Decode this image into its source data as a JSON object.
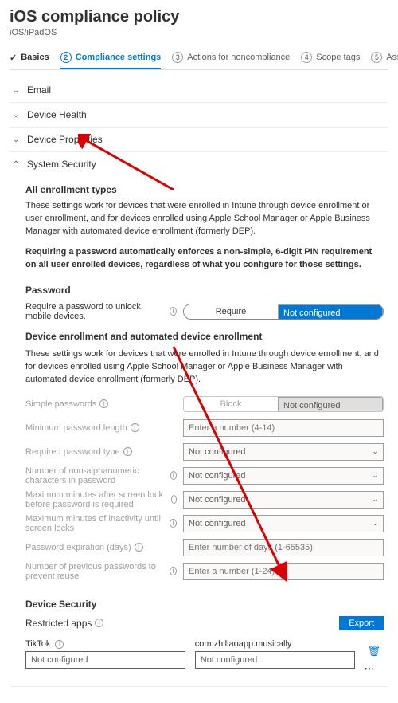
{
  "header": {
    "title": "iOS compliance policy",
    "subtitle": "iOS/iPadOS"
  },
  "wizard": {
    "s1": "Basics",
    "s2": "Compliance settings",
    "s3": "Actions for noncompliance",
    "s4": "Scope tags",
    "s5": "Assignments",
    "n2": "2",
    "n3": "3",
    "n4": "4",
    "n5": "5"
  },
  "sections": {
    "email": "Email",
    "health": "Device Health",
    "props": "Device Properties",
    "security": "System Security"
  },
  "content": {
    "allEnroll": "All enrollment types",
    "allEnrollDesc": "These settings work for devices that were enrolled in Intune through device enrollment or user enrollment, and for devices enrolled using Apple School Manager or Apple Business Manager with automated device enrollment (formerly DEP).",
    "pinDesc": "Requiring a password automatically enforces a non-simple, 6-digit PIN requirement on all user enrolled devices, regardless of what you configure for those settings.",
    "password": "Password",
    "reqPwd": "Require a password to unlock mobile devices.",
    "require": "Require",
    "notConfigured": "Not configured",
    "deEnroll": "Device enrollment and automated device enrollment",
    "deEnrollDesc": "These settings work for devices that were enrolled in Intune through device enrollment, and for devices enrolled using Apple School Manager or Apple Business Manager with automated device enrollment (formerly DEP).",
    "simplePwd": "Simple passwords",
    "block": "Block",
    "minLen": "Minimum password length",
    "minLenPh": "Enter a number (4-14)",
    "reqType": "Required password type",
    "nonAlpha": "Number of non-alphanumeric characters in password",
    "maxLock": "Maximum minutes after screen lock before password is required",
    "maxInact": "Maximum minutes of inactivity until screen locks",
    "pwdExp": "Password expiration (days)",
    "pwdExpPh": "Enter number of days (1-65535)",
    "prevPwd": "Number of previous passwords to prevent reuse",
    "prevPwdPh": "Enter a number (1-24)",
    "devSec": "Device Security",
    "restricted": "Restricted apps",
    "export": "Export",
    "appName": "TikTok",
    "bundleId": "com.zhiliaoapp.musically"
  }
}
